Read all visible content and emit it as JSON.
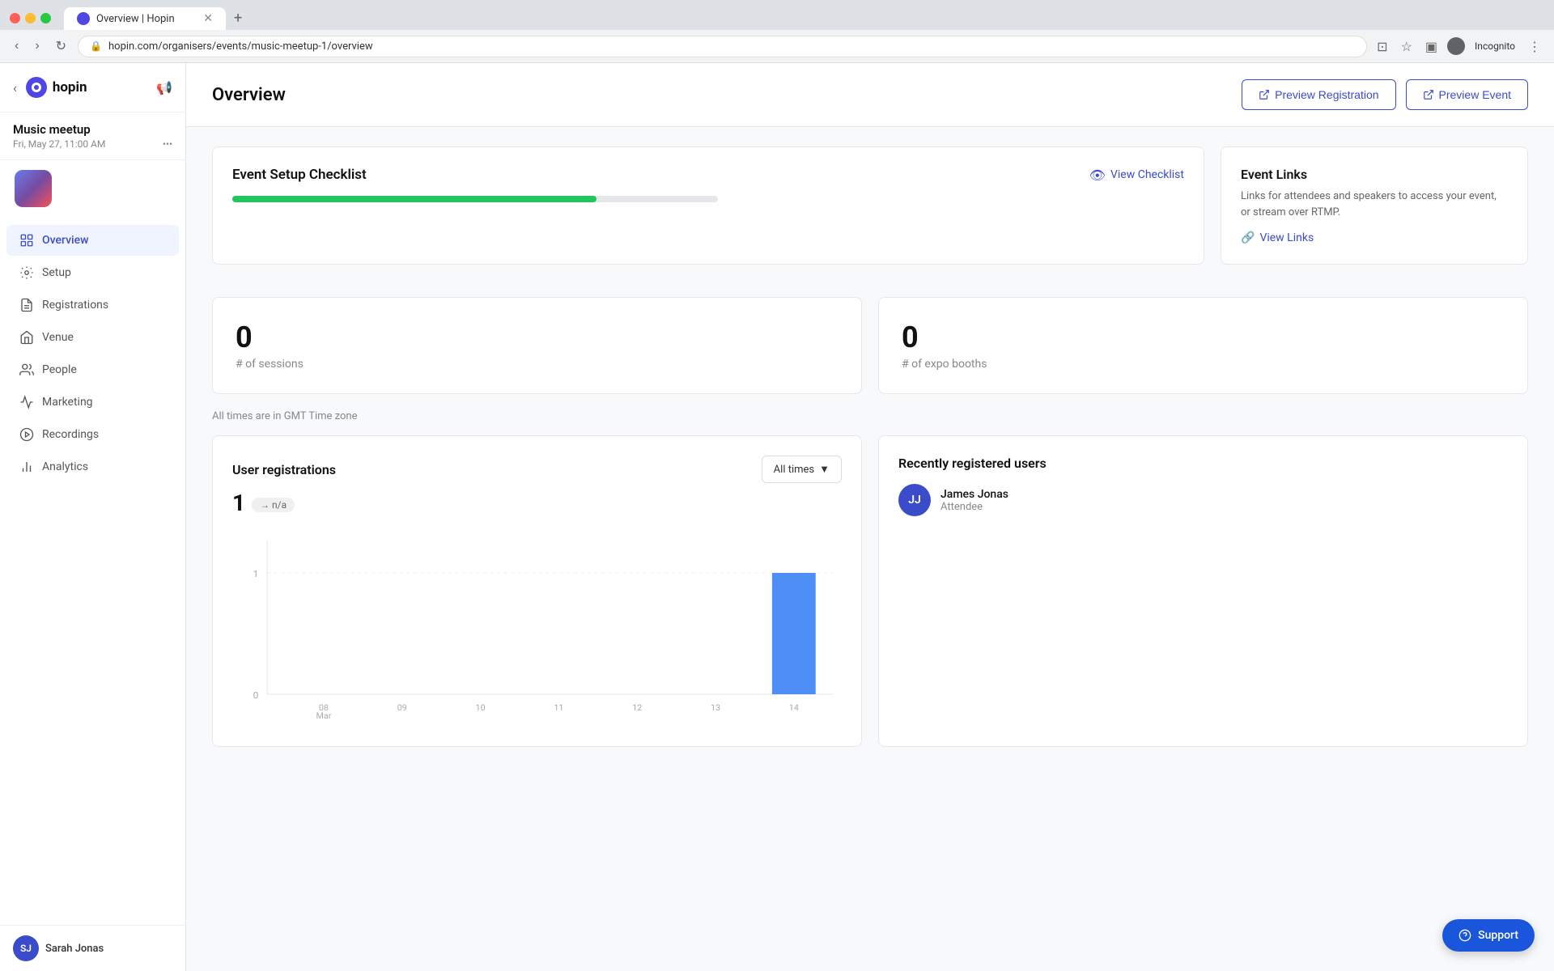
{
  "browser": {
    "tab_title": "Overview | Hopin",
    "url": "hopin.com/organisers/events/music-meetup-1/overview",
    "tab_new_label": "+",
    "profile_label": "Incognito"
  },
  "sidebar": {
    "back_label": "‹",
    "logo_text": "hopin",
    "notification_label": "📢",
    "event_name": "Music meetup",
    "event_date": "Fri, May 27, 11:00 AM",
    "nav_items": [
      {
        "id": "overview",
        "label": "Overview",
        "active": true
      },
      {
        "id": "setup",
        "label": "Setup",
        "active": false
      },
      {
        "id": "registrations",
        "label": "Registrations",
        "active": false
      },
      {
        "id": "venue",
        "label": "Venue",
        "active": false
      },
      {
        "id": "people",
        "label": "People",
        "active": false
      },
      {
        "id": "marketing",
        "label": "Marketing",
        "active": false
      },
      {
        "id": "recordings",
        "label": "Recordings",
        "active": false
      },
      {
        "id": "analytics",
        "label": "Analytics",
        "active": false
      }
    ],
    "user_initials": "SJ",
    "user_name": "Sarah Jonas"
  },
  "header": {
    "page_title": "Overview",
    "preview_registration_label": "Preview Registration",
    "preview_event_label": "Preview Event"
  },
  "checklist": {
    "title": "Event Setup Checklist",
    "view_label": "View Checklist",
    "progress_pct": 75
  },
  "event_links": {
    "title": "Event Links",
    "description": "Links for attendees and speakers to access your event, or stream over RTMP.",
    "view_label": "View Links"
  },
  "stats": [
    {
      "value": "0",
      "label": "# of sessions"
    },
    {
      "value": "0",
      "label": "# of expo booths"
    }
  ],
  "timezone_note": "All times are in GMT Time zone",
  "chart": {
    "title": "User registrations",
    "filter_label": "All times",
    "count": "1",
    "badge": "→ n/a",
    "y_max": 1,
    "x_labels": [
      "08\nMar",
      "09",
      "10",
      "11",
      "12",
      "13",
      "14"
    ],
    "bar_data": [
      0,
      0,
      0,
      0,
      0,
      0,
      1
    ]
  },
  "recently_registered": {
    "title": "Recently registered users",
    "users": [
      {
        "initials": "JJ",
        "name": "James Jonas",
        "role": "Attendee"
      }
    ]
  },
  "support_button": {
    "label": "Support"
  }
}
